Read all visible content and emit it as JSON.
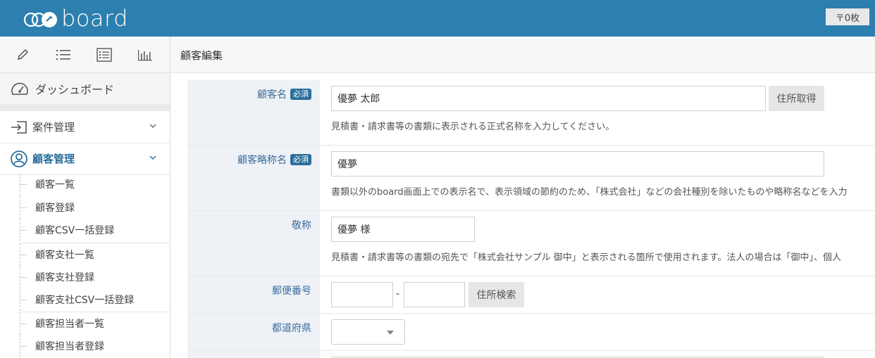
{
  "header": {
    "brand": "board",
    "cart_label": "〒0枚"
  },
  "toolbar": {
    "icons": [
      "pencil-icon",
      "list-icon",
      "detail-list-icon",
      "chart-icon"
    ]
  },
  "page": {
    "title": "顧客編集"
  },
  "sidebar": {
    "dashboard": "ダッシュボード",
    "sections": [
      {
        "label": "案件管理",
        "active": false
      },
      {
        "label": "顧客管理",
        "active": true
      }
    ],
    "groups": [
      [
        "顧客一覧",
        "顧客登録",
        "顧客CSV一括登録"
      ],
      [
        "顧客支社一覧",
        "顧客支社登録",
        "顧客支社CSV一括登録"
      ],
      [
        "顧客担当者一覧",
        "顧客担当者登録"
      ]
    ]
  },
  "form": {
    "required_label": "必須",
    "name": {
      "label": "顧客名",
      "value": "優夢 太郎",
      "button": "住所取得",
      "help": "見積書・請求書等の書類に表示される正式名称を入力してください。"
    },
    "short_name": {
      "label": "顧客略称名",
      "value": "優夢",
      "help": "書類以外のboard画面上での表示名で、表示領域の節約のため、「株式会社」などの会社種別を除いたものや略称名などを入力"
    },
    "honorific": {
      "label": "敬称",
      "value": "優夢 様",
      "help": "見積書・請求書等の書類の宛先で「株式会社サンプル 御中」と表示される箇所で使用されます。法人の場合は「御中」、個人"
    },
    "postal": {
      "label": "郵便番号",
      "value1": "",
      "value2": "",
      "separator": "-",
      "button": "住所検索"
    },
    "prefecture": {
      "label": "都道府県",
      "value": ""
    }
  },
  "colors": {
    "header_bg": "#2c7fae",
    "accent": "#2a6f9b",
    "label_bg": "#eef1f6"
  }
}
